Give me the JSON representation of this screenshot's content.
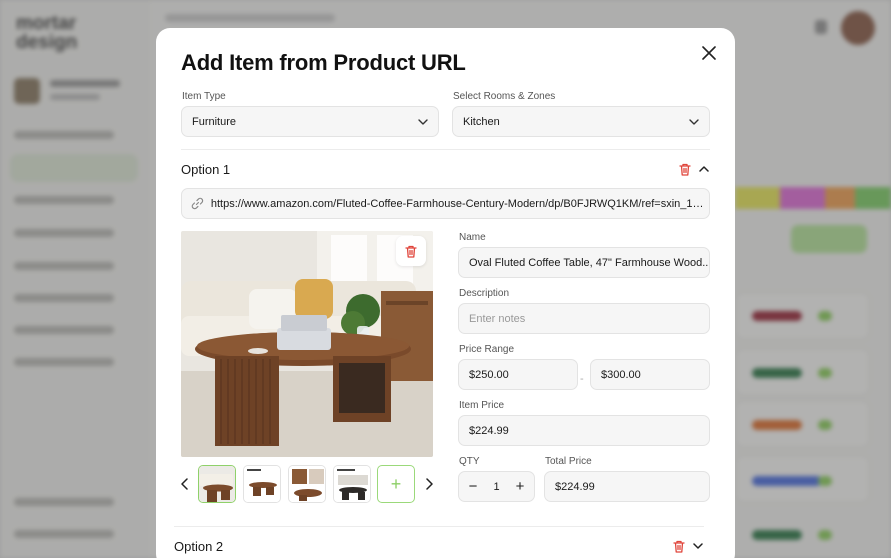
{
  "background": {
    "logo": "mortar\ndesign"
  },
  "modal": {
    "title": "Add Item from Product URL",
    "item_type": {
      "label": "Item Type",
      "value": "Furniture"
    },
    "rooms": {
      "label": "Select Rooms & Zones",
      "value": "Kitchen"
    },
    "options": [
      {
        "title": "Option 1",
        "url": "https://www.amazon.com/Fluted-Coffee-Farmhouse-Century-Modern/dp/B0FJRWQ1KM/ref=sxin_17_...",
        "name_label": "Name",
        "name_value": "Oval Fluted Coffee Table, 47\" Farmhouse Wood...",
        "description_label": "Description",
        "description_placeholder": "Enter notes",
        "price_range_label": "Price Range",
        "price_min": "$250.00",
        "price_sep": "-",
        "price_max": "$300.00",
        "item_price_label": "Item Price",
        "item_price": "$224.99",
        "qty_label": "QTY",
        "qty_value": "1",
        "qty_minus": "−",
        "qty_plus": "+",
        "total_price_label": "Total Price",
        "total_price": "$224.99",
        "add_image": "+"
      },
      {
        "title": "Option 2"
      }
    ]
  },
  "colors": {
    "accent_green": "#8fd16a",
    "delete_red": "#e0443a"
  },
  "icons": [
    "close-icon",
    "chevron-down-icon",
    "chevron-up-icon",
    "trash-icon",
    "link-icon",
    "chevron-left-icon",
    "chevron-right-icon",
    "plus-icon"
  ]
}
